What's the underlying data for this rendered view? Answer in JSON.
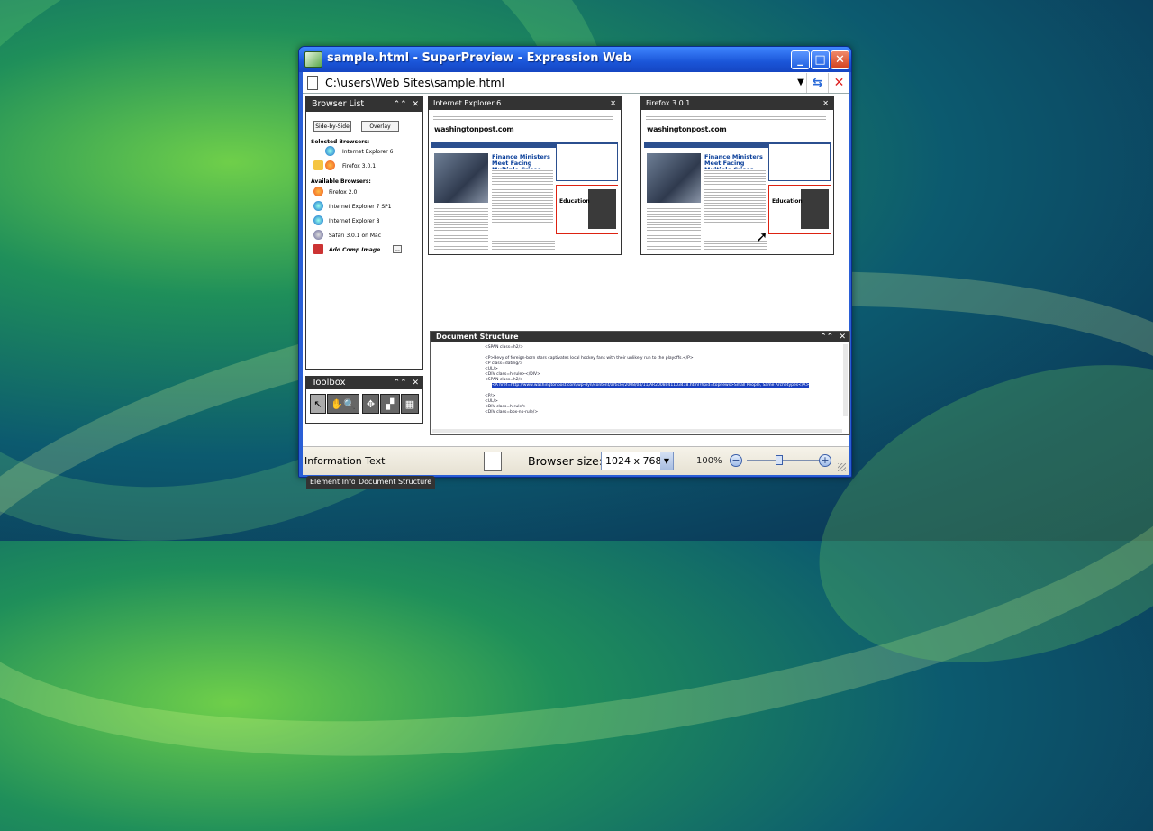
{
  "window": {
    "title": "sample.html - SuperPreview - Expression Web"
  },
  "address_bar": {
    "path": "C:\\users\\Web Sites\\sample.html"
  },
  "browser_list": {
    "title": "Browser List",
    "side_by_side": "Side-by-Side",
    "overlay": "Overlay",
    "selected_heading": "Selected Browsers:",
    "selected": [
      "Internet Explorer 6",
      "Firefox 3.0.1"
    ],
    "available_heading": "Available Browsers:",
    "available": [
      "Firefox 2.0",
      "Internet Explorer 7 SP1",
      "Internet Explorer 8",
      "Safari 3.0.1 on Mac"
    ],
    "add_comp": "Add Comp Image",
    "browse_btn": "..."
  },
  "preview_left": {
    "title": "Internet Explorer 6",
    "logo": "washingtonpost.com",
    "headline": "Finance Ministers Meet Facing Multiple Crises",
    "box_title": "Education"
  },
  "preview_right": {
    "title": "Firefox 3.0.1",
    "logo": "washingtonpost.com",
    "headline": "Finance Ministers Meet Facing Multiple Crises",
    "box_title": "Education"
  },
  "toolbox": {
    "title": "Toolbox"
  },
  "doc_structure": {
    "title": "Document Structure",
    "lines": [
      "<SPAN class=h2/>",
      "<P>Bevy of foreign-born stars captivates local hockey fans with their unlikely run to the playoffs.</P>",
      "<P class=dating/>",
      "<UL/>",
      "<DIV class=h-rule></DIV>",
      "<SPAN class=h2/>",
      "<A href=http://www.washingtonpost.com/wp-dyn/content/article/2008/04/11/AR2008041103418.html?hpid=topnews>Small People, Same Archetypes</A>",
      "<P/>",
      "<UL/>",
      "<DIV class=h-rule/>",
      "<DIV class=box-no-rule/>"
    ]
  },
  "bottom_tabs": [
    "Element Info",
    "Document Structure"
  ],
  "status": {
    "info": "Information Text",
    "browser_size_label": "Browser size:",
    "browser_size_value": "1024 x 768",
    "zoom": "100%"
  }
}
